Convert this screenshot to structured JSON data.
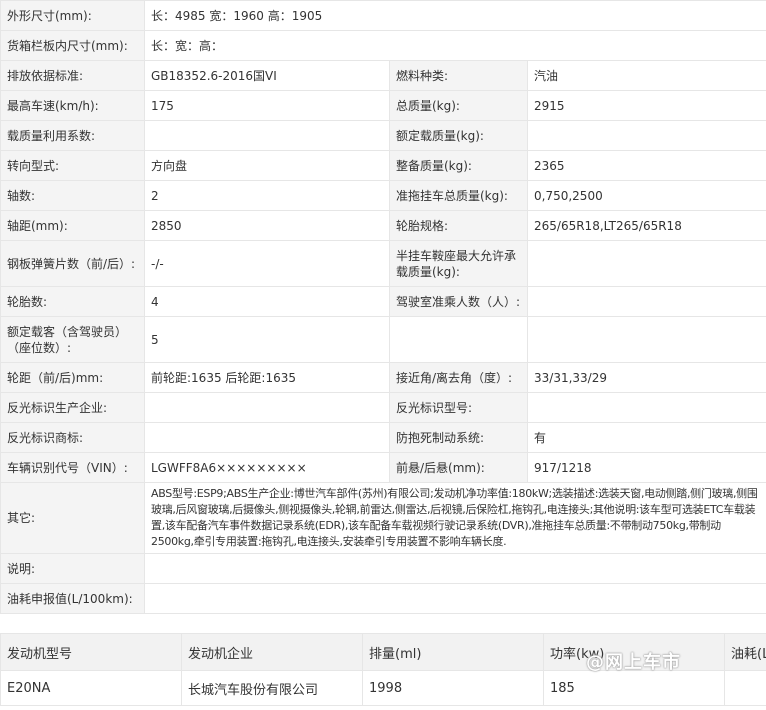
{
  "specs": {
    "row1": {
      "label": "外形尺寸(mm):",
      "value": "长：4985 宽：1960 高：1905"
    },
    "row2": {
      "label": "货箱栏板内尺寸(mm):",
      "value": "长：宽：高："
    },
    "row3": {
      "label1": "排放依据标准:",
      "value1": "GB18352.6-2016国VI",
      "label2": "燃料种类:",
      "value2": "汽油"
    },
    "row4": {
      "label1": "最高车速(km/h):",
      "value1": "175",
      "label2": "总质量(kg):",
      "value2": "2915"
    },
    "row5": {
      "label1": "载质量利用系数:",
      "value1": "",
      "label2": "额定载质量(kg):",
      "value2": ""
    },
    "row6": {
      "label1": "转向型式:",
      "value1": "方向盘",
      "label2": "整备质量(kg):",
      "value2": "2365"
    },
    "row7": {
      "label1": "轴数:",
      "value1": "2",
      "label2": "准拖挂车总质量(kg):",
      "value2": "0,750,2500"
    },
    "row8": {
      "label1": "轴距(mm):",
      "value1": "2850",
      "label2": "轮胎规格:",
      "value2": "265/65R18,LT265/65R18"
    },
    "row9": {
      "label1": "钢板弹簧片数（前/后）:",
      "value1": "-/-",
      "label2": "半挂车鞍座最大允许承载质量(kg):",
      "value2": ""
    },
    "row10": {
      "label1": "轮胎数:",
      "value1": "4",
      "label2": "驾驶室准乘人数（人）:",
      "value2": ""
    },
    "row11": {
      "label1": "额定载客（含驾驶员）（座位数）:",
      "value1": "5",
      "label2": "",
      "value2": ""
    },
    "row12": {
      "label1": "轮距（前/后)mm:",
      "value1": "前轮距:1635 后轮距:1635",
      "label2": "接近角/离去角（度）:",
      "value2": "33/31,33/29"
    },
    "row13": {
      "label1": "反光标识生产企业:",
      "value1": "",
      "label2": "反光标识型号:",
      "value2": ""
    },
    "row14": {
      "label1": "反光标识商标:",
      "value1": "",
      "label2": "防抱死制动系统:",
      "value2": "有"
    },
    "row15": {
      "label1": "车辆识别代号（VIN）:",
      "value1": "LGWFF8A6×××××××××",
      "label2": "前悬/后悬(mm):",
      "value2": "917/1218"
    },
    "row16": {
      "label": "其它:",
      "value": "ABS型号:ESP9;ABS生产企业:博世汽车部件(苏州)有限公司;发动机净功率值:180kW;选装描述:选装天窗,电动侧踏,侧门玻璃,侧围玻璃,后风窗玻璃,后摄像头,侧视摄像头,轮辋,前雷达,侧雷达,后视镜,后保险杠,拖钩孔,电连接头;其他说明:该车型可选装ETC车载装置,该车配备汽车事件数据记录系统(EDR),该车配备车载视频行驶记录系统(DVR),准拖挂车总质量:不带制动750kg,带制动2500kg,牵引专用装置:拖钩孔,电连接头,安装牵引专用装置不影响车辆长度."
    },
    "row17": {
      "label": "说明:",
      "value": ""
    },
    "row18": {
      "label": "油耗申报值(L/100km):",
      "value": ""
    }
  },
  "engine": {
    "headers": [
      "发动机型号",
      "发动机企业",
      "排量(ml)",
      "功率(kw)",
      "油耗(L"
    ],
    "row": [
      "E20NA",
      "长城汽车股份有限公司",
      "1998",
      "185",
      ""
    ]
  },
  "watermark": "@网上车市"
}
